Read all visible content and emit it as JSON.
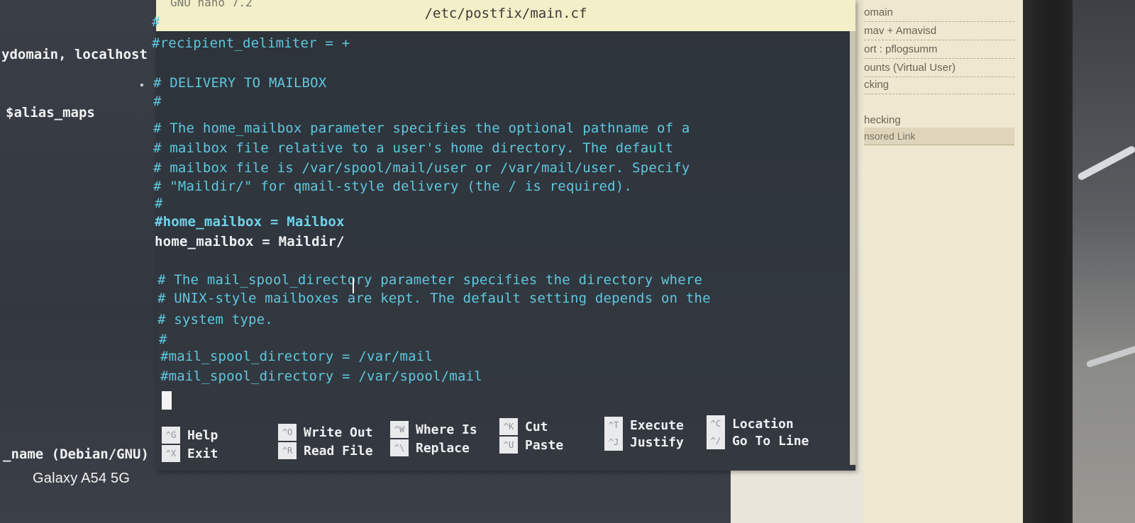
{
  "background_terminal": {
    "lines": [
      "ydomain, localhost",
      "$alias_maps",
      "_name (Debian/GNU)"
    ]
  },
  "phone_watermark": "Galaxy A54 5G",
  "background_browser": {
    "sidebar_items": [
      "omain",
      "mav + Amavisd",
      "ort : pflogsumm",
      "ounts (Virtual User)",
      "cking",
      "hecking"
    ],
    "sponsored": "nsored Link"
  },
  "nano": {
    "version_label": "GNU nano 7.2",
    "filename": "/etc/postfix/main.cf",
    "lines": [
      "#",
      "#recipient_delimiter = +",
      "# DELIVERY TO MAILBOX",
      "#",
      "# The home_mailbox parameter specifies the optional pathname of a",
      "# mailbox file relative to a user's home directory. The default",
      "# mailbox file is /var/spool/mail/user or /var/mail/user.  Specify",
      "# \"Maildir/\" for qmail-style delivery (the / is required).",
      "#",
      "#home_mailbox = Mailbox",
      "home_mailbox = Maildir/",
      "# The mail_spool_directory parameter specifies the directory where",
      "# UNIX-style mailboxes are kept. The default setting depends on the",
      "# system type.",
      "#",
      "#mail_spool_directory = /var/mail",
      "#mail_spool_directory = /var/spool/mail"
    ],
    "shortcuts": [
      {
        "key": "^G",
        "label": "Help"
      },
      {
        "key": "^X",
        "label": "Exit"
      },
      {
        "key": "^O",
        "label": "Write Out"
      },
      {
        "key": "^R",
        "label": "Read File"
      },
      {
        "key": "^W",
        "label": "Where Is"
      },
      {
        "key": "^\\",
        "label": "Replace"
      },
      {
        "key": "^K",
        "label": "Cut"
      },
      {
        "key": "^U",
        "label": "Paste"
      },
      {
        "key": "^T",
        "label": "Execute"
      },
      {
        "key": "^J",
        "label": "Justify"
      },
      {
        "key": "^C",
        "label": "Location"
      },
      {
        "key": "^/",
        "label": "Go To Line"
      }
    ]
  },
  "colors": {
    "comment_text": "#5ec8e0",
    "setting_text": "#eef0f2",
    "titlebar_bg": "#f2efc9",
    "editor_bg": "#30363d"
  }
}
